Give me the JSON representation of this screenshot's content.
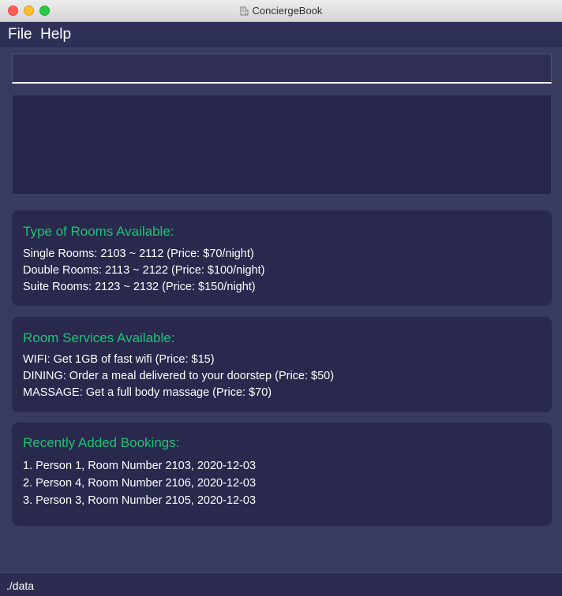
{
  "window": {
    "title": "ConciergeBook"
  },
  "menu": {
    "file": "File",
    "help": "Help"
  },
  "command": {
    "value": "",
    "placeholder": ""
  },
  "result": {
    "text": ""
  },
  "rooms": {
    "title": "Type of Rooms Available:",
    "lines": [
      "Single Rooms: 2103 ~ 2112 (Price: $70/night)",
      "Double Rooms: 2113 ~ 2122 (Price: $100/night)",
      "Suite Rooms: 2123 ~ 2132 (Price: $150/night)"
    ]
  },
  "services": {
    "title": "Room Services Available:",
    "lines": [
      "WIFI: Get 1GB of fast wifi (Price: $15)",
      "DINING: Order a meal delivered to your doorstep (Price: $50)",
      "MASSAGE: Get a full body massage (Price: $70)"
    ]
  },
  "bookings": {
    "title": "Recently Added Bookings:",
    "lines": [
      "1. Person 1, Room Number 2103, 2020-12-03",
      "2. Person 4, Room Number 2106, 2020-12-03",
      "3. Person 3, Room Number 2105, 2020-12-03"
    ]
  },
  "status": {
    "path": "./data"
  },
  "colors": {
    "background": "#383a5e",
    "card": "#28294d",
    "accent": "#1fc275",
    "traffic_close": "#fc5f57",
    "traffic_minimize": "#fdbc2f",
    "traffic_maximize": "#29c940"
  }
}
